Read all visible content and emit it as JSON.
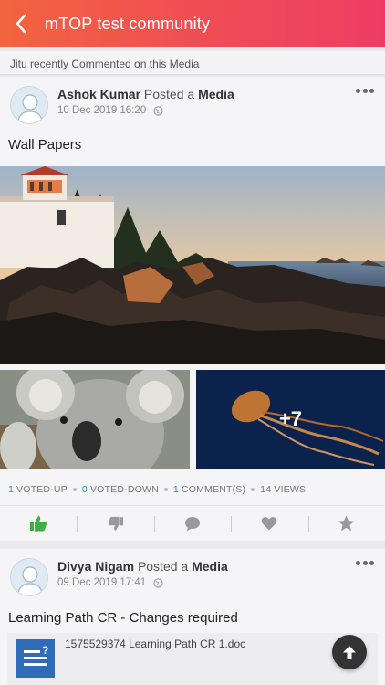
{
  "header": {
    "title": "mTOP test community"
  },
  "activity_text": "Jitu recently Commented on this Media",
  "posts": [
    {
      "author": "Ashok Kumar",
      "action_text": "Posted a",
      "object": "Media",
      "date": "10 Dec 2019 16:20",
      "title": "Wall Papers",
      "more_count": "+7",
      "stats": {
        "votes_up": "1",
        "votes_up_label": "VOTED-UP",
        "votes_down": "0",
        "votes_down_label": "VOTED-DOWN",
        "comments": "1",
        "comments_label": "COMMENT(S)",
        "views": "14 VIEWS"
      }
    },
    {
      "author": "Divya Nigam",
      "action_text": "Posted a",
      "object": "Media",
      "date": "09 Dec 2019 17:41",
      "title": "Learning Path CR - Changes required",
      "attachment_name": "1575529374 Learning Path CR 1.doc"
    }
  ],
  "colors": {
    "header_start": "#f2643f",
    "header_end": "#ee3d64",
    "link_blue": "#2b8ad6",
    "upvote_green": "#3cb043",
    "doc_blue": "#2f6bb6"
  },
  "icons": [
    "back-arrow-icon",
    "globe-icon",
    "more-icon",
    "thumbs-up-icon",
    "thumbs-down-icon",
    "comment-icon",
    "heart-icon",
    "star-icon",
    "doc-icon",
    "scroll-top-icon"
  ]
}
